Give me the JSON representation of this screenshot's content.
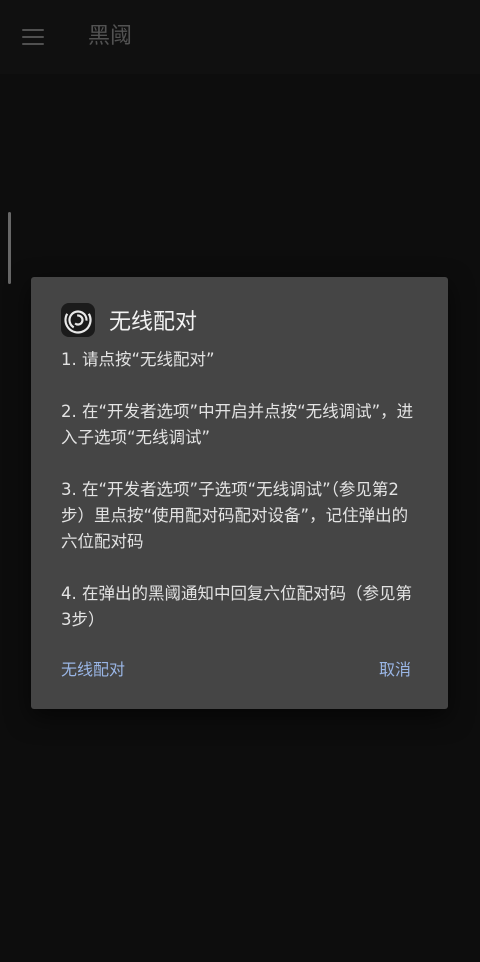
{
  "app": {
    "title": "黑阈",
    "menu_icon": "hamburger-menu-icon"
  },
  "dialog": {
    "icon": "swirl-app-icon",
    "title": "无线配对",
    "steps": [
      "1. 请点按“无线配对”",
      "2. 在“开发者选项”中开启并点按“无线调试”，进入子选项“无线调试”",
      "3. 在“开发者选项”子选项“无线调试”（参见第2步）里点按“使用配对码配对设备”，记住弹出的六位配对码",
      "4. 在弹出的黑阈通知中回复六位配对码（参见第3步）"
    ],
    "positive_button": "无线配对",
    "negative_button": "取消"
  },
  "colors": {
    "background": "#111111",
    "dialog_background": "#454545",
    "accent": "#9ab6e6"
  }
}
